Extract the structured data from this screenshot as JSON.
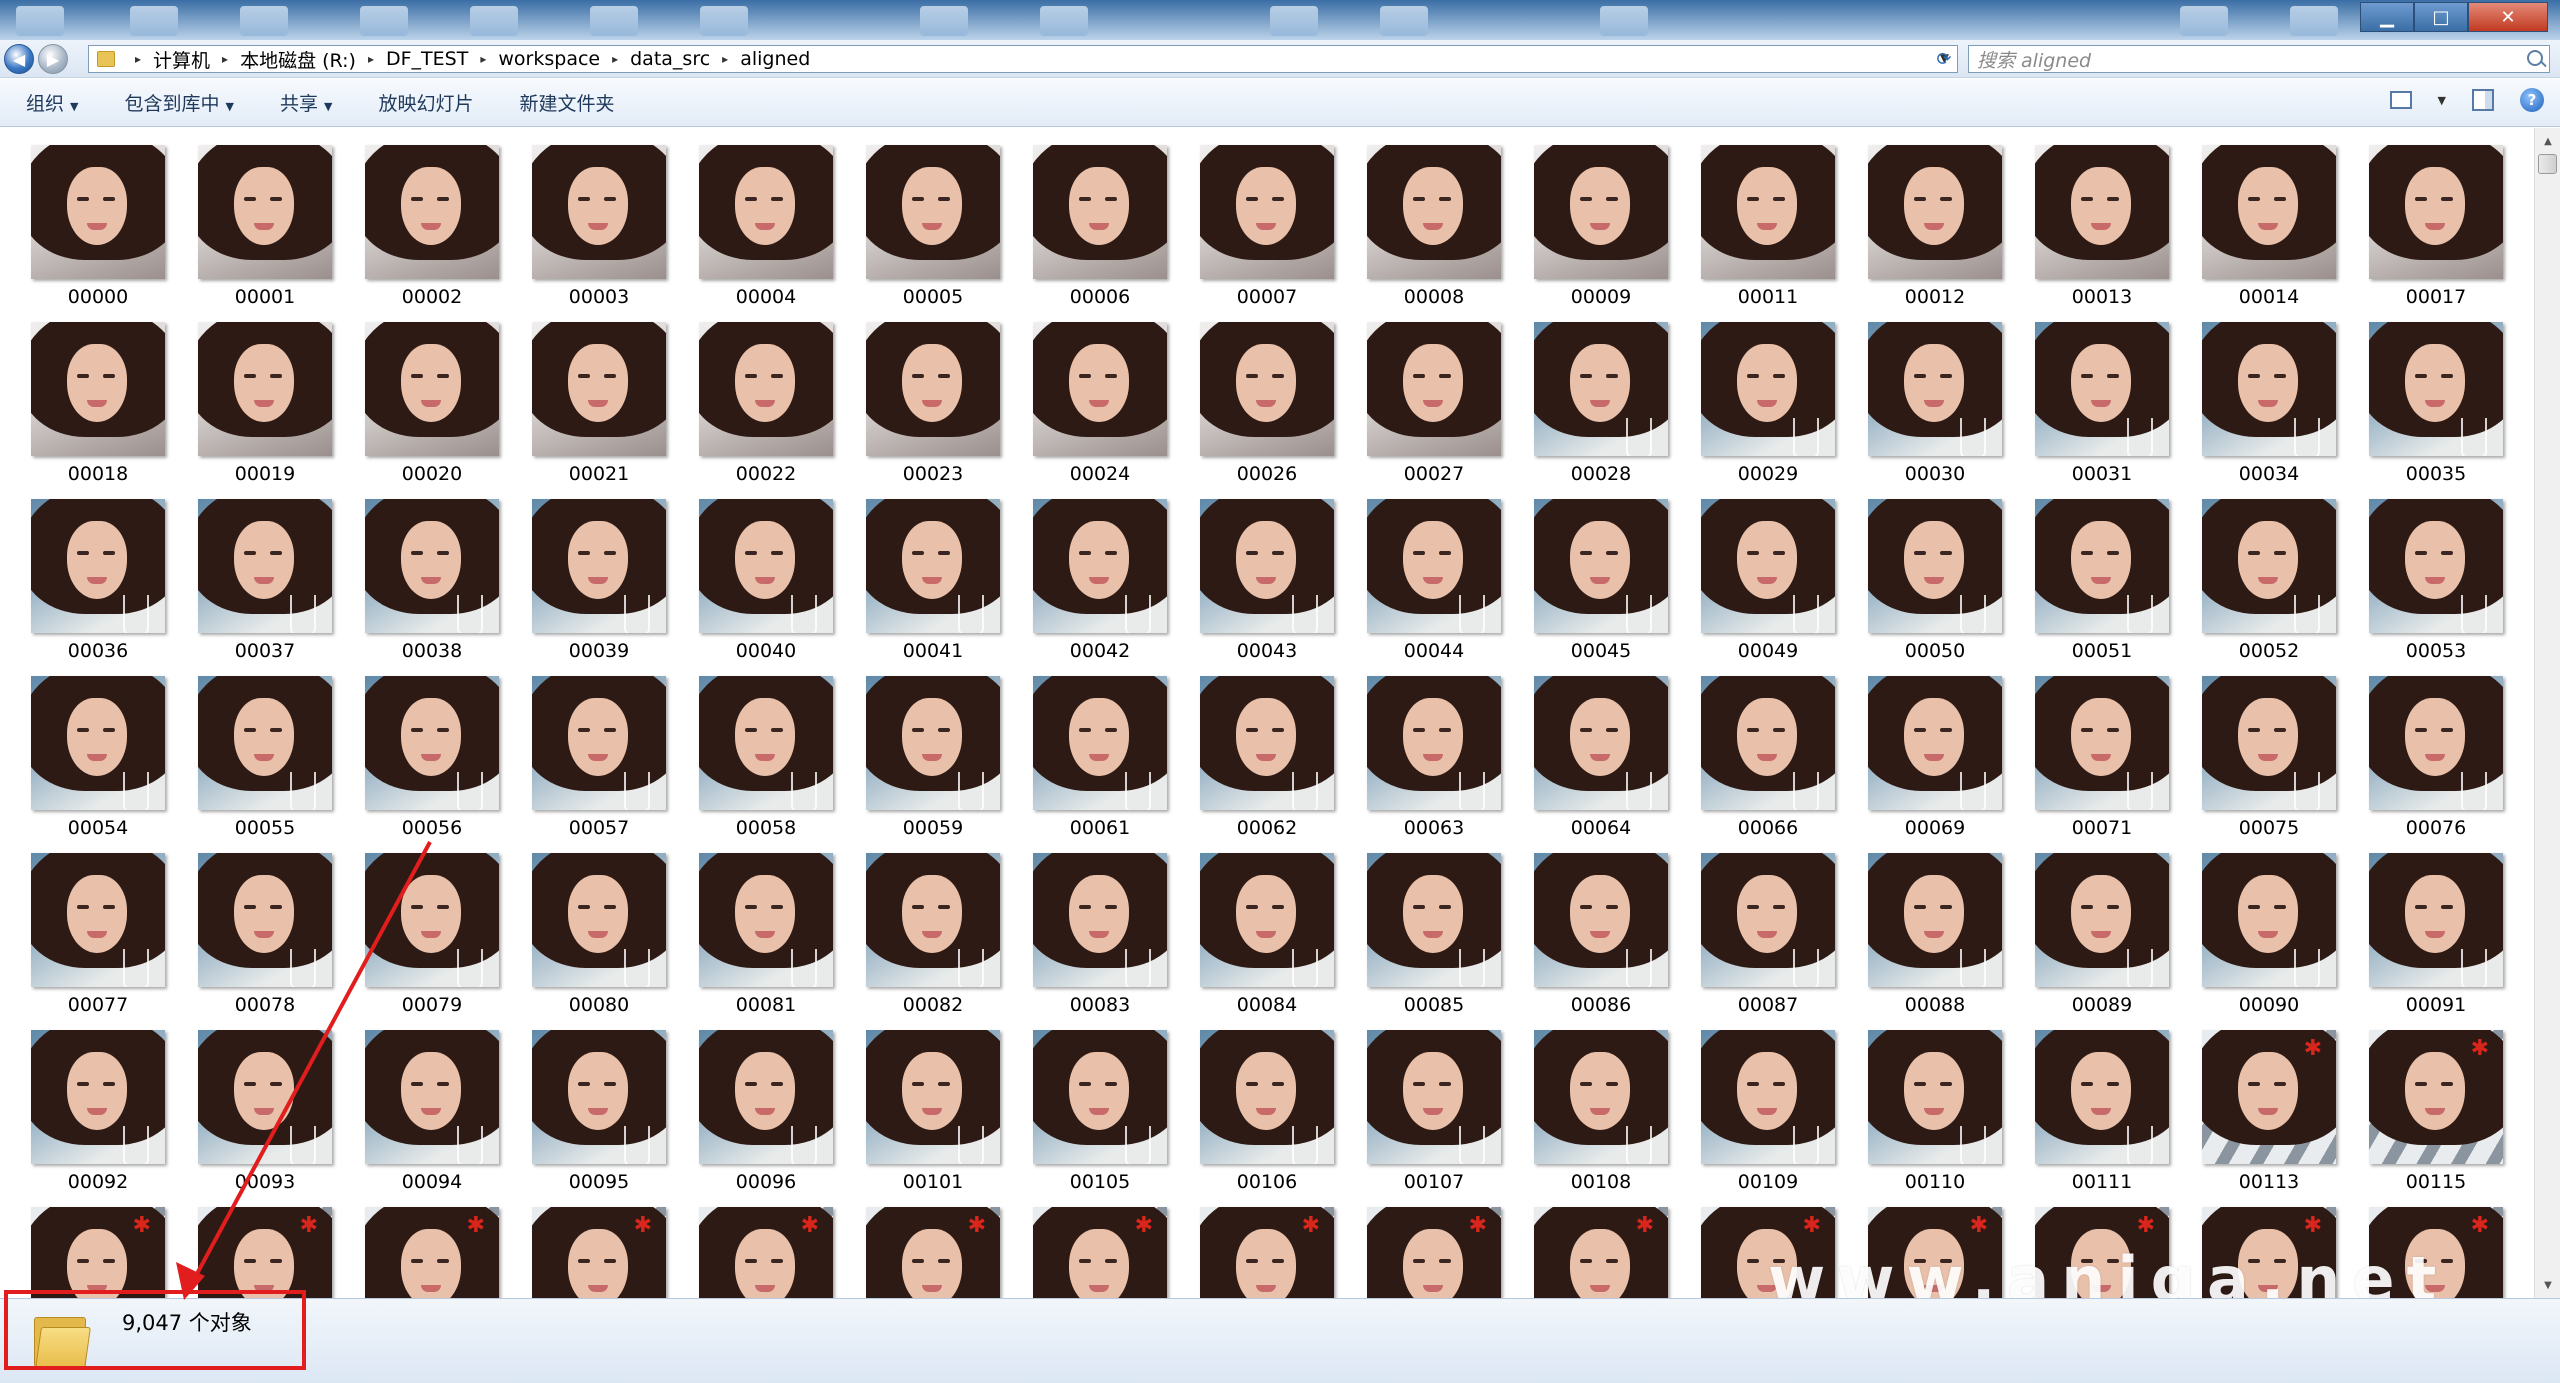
{
  "window": {
    "controls": {
      "minimize": "▁",
      "maximize": "□",
      "close": "✕"
    }
  },
  "address": {
    "breadcrumbs": [
      "计算机",
      "本地磁盘 (R:)",
      "DF_TEST",
      "workspace",
      "data_src",
      "aligned"
    ],
    "search_placeholder": "搜索 aligned"
  },
  "toolbar": {
    "items": [
      {
        "label": "组织",
        "dropdown": true
      },
      {
        "label": "包含到库中",
        "dropdown": true
      },
      {
        "label": "共享",
        "dropdown": true
      },
      {
        "label": "放映幻灯片",
        "dropdown": false
      },
      {
        "label": "新建文件夹",
        "dropdown": false
      }
    ],
    "right_icons": [
      "view-options-icon",
      "preview-pane-icon",
      "help-icon"
    ],
    "help_glyph": "?"
  },
  "files": [
    {
      "name": "00000",
      "thumb": "pillow"
    },
    {
      "name": "00001",
      "thumb": "pillow"
    },
    {
      "name": "00002",
      "thumb": "pillow"
    },
    {
      "name": "00003",
      "thumb": "pillow"
    },
    {
      "name": "00004",
      "thumb": "pillow"
    },
    {
      "name": "00005",
      "thumb": "pillow"
    },
    {
      "name": "00006",
      "thumb": "pillow"
    },
    {
      "name": "00007",
      "thumb": "pillow"
    },
    {
      "name": "00008",
      "thumb": "pillow"
    },
    {
      "name": "00009",
      "thumb": "pillow"
    },
    {
      "name": "00011",
      "thumb": "pillow"
    },
    {
      "name": "00012",
      "thumb": "pillow"
    },
    {
      "name": "00013",
      "thumb": "pillow"
    },
    {
      "name": "00014",
      "thumb": "pillow"
    },
    {
      "name": "00017",
      "thumb": "pillow"
    },
    {
      "name": "00018",
      "thumb": "pillow"
    },
    {
      "name": "00019",
      "thumb": "pillow"
    },
    {
      "name": "00020",
      "thumb": "pillow"
    },
    {
      "name": "00021",
      "thumb": "pillow"
    },
    {
      "name": "00022",
      "thumb": "pillow"
    },
    {
      "name": "00023",
      "thumb": "pillow"
    },
    {
      "name": "00024",
      "thumb": "pillow"
    },
    {
      "name": "00026",
      "thumb": "pillow"
    },
    {
      "name": "00027",
      "thumb": "pillow"
    },
    {
      "name": "00028",
      "thumb": "blue"
    },
    {
      "name": "00029",
      "thumb": "blue"
    },
    {
      "name": "00030",
      "thumb": "blue"
    },
    {
      "name": "00031",
      "thumb": "blue"
    },
    {
      "name": "00034",
      "thumb": "blue"
    },
    {
      "name": "00035",
      "thumb": "blue"
    },
    {
      "name": "00036",
      "thumb": "blue"
    },
    {
      "name": "00037",
      "thumb": "blue"
    },
    {
      "name": "00038",
      "thumb": "blue"
    },
    {
      "name": "00039",
      "thumb": "blue"
    },
    {
      "name": "00040",
      "thumb": "blue"
    },
    {
      "name": "00041",
      "thumb": "blue"
    },
    {
      "name": "00042",
      "thumb": "blue"
    },
    {
      "name": "00043",
      "thumb": "blue"
    },
    {
      "name": "00044",
      "thumb": "blue"
    },
    {
      "name": "00045",
      "thumb": "blue"
    },
    {
      "name": "00049",
      "thumb": "blue"
    },
    {
      "name": "00050",
      "thumb": "blue"
    },
    {
      "name": "00051",
      "thumb": "blue"
    },
    {
      "name": "00052",
      "thumb": "blue"
    },
    {
      "name": "00053",
      "thumb": "blue"
    },
    {
      "name": "00054",
      "thumb": "blue"
    },
    {
      "name": "00055",
      "thumb": "blue"
    },
    {
      "name": "00056",
      "thumb": "blue"
    },
    {
      "name": "00057",
      "thumb": "blue"
    },
    {
      "name": "00058",
      "thumb": "blue"
    },
    {
      "name": "00059",
      "thumb": "blue"
    },
    {
      "name": "00061",
      "thumb": "blue"
    },
    {
      "name": "00062",
      "thumb": "blue"
    },
    {
      "name": "00063",
      "thumb": "blue"
    },
    {
      "name": "00064",
      "thumb": "blue"
    },
    {
      "name": "00066",
      "thumb": "blue"
    },
    {
      "name": "00069",
      "thumb": "blue"
    },
    {
      "name": "00071",
      "thumb": "blue"
    },
    {
      "name": "00075",
      "thumb": "blue"
    },
    {
      "name": "00076",
      "thumb": "blue"
    },
    {
      "name": "00077",
      "thumb": "blue"
    },
    {
      "name": "00078",
      "thumb": "blue"
    },
    {
      "name": "00079",
      "thumb": "blue"
    },
    {
      "name": "00080",
      "thumb": "blue"
    },
    {
      "name": "00081",
      "thumb": "blue"
    },
    {
      "name": "00082",
      "thumb": "blue"
    },
    {
      "name": "00083",
      "thumb": "blue"
    },
    {
      "name": "00084",
      "thumb": "blue"
    },
    {
      "name": "00085",
      "thumb": "blue"
    },
    {
      "name": "00086",
      "thumb": "blue"
    },
    {
      "name": "00087",
      "thumb": "blue"
    },
    {
      "name": "00088",
      "thumb": "blue"
    },
    {
      "name": "00089",
      "thumb": "blue"
    },
    {
      "name": "00090",
      "thumb": "blue"
    },
    {
      "name": "00091",
      "thumb": "blue"
    },
    {
      "name": "00092",
      "thumb": "blue"
    },
    {
      "name": "00093",
      "thumb": "blue"
    },
    {
      "name": "00094",
      "thumb": "blue"
    },
    {
      "name": "00095",
      "thumb": "blue"
    },
    {
      "name": "00096",
      "thumb": "blue"
    },
    {
      "name": "00101",
      "thumb": "blue"
    },
    {
      "name": "00105",
      "thumb": "blue"
    },
    {
      "name": "00106",
      "thumb": "blue"
    },
    {
      "name": "00107",
      "thumb": "blue"
    },
    {
      "name": "00108",
      "thumb": "blue"
    },
    {
      "name": "00109",
      "thumb": "blue"
    },
    {
      "name": "00110",
      "thumb": "blue"
    },
    {
      "name": "00111",
      "thumb": "blue"
    },
    {
      "name": "00113",
      "thumb": "stripe"
    },
    {
      "name": "00115",
      "thumb": "stripe"
    },
    {
      "name": "",
      "thumb": "stripe"
    },
    {
      "name": "",
      "thumb": "stripe"
    },
    {
      "name": "",
      "thumb": "stripe"
    },
    {
      "name": "",
      "thumb": "stripe"
    },
    {
      "name": "",
      "thumb": "stripe"
    },
    {
      "name": "",
      "thumb": "stripe"
    },
    {
      "name": "",
      "thumb": "stripe"
    },
    {
      "name": "",
      "thumb": "stripe"
    },
    {
      "name": "",
      "thumb": "stripe"
    },
    {
      "name": "",
      "thumb": "stripe"
    },
    {
      "name": "",
      "thumb": "stripe"
    },
    {
      "name": "",
      "thumb": "stripe"
    },
    {
      "name": "",
      "thumb": "stripe"
    },
    {
      "name": "",
      "thumb": "stripe"
    },
    {
      "name": "",
      "thumb": "stripe"
    }
  ],
  "status": {
    "count_text": "9,047 个对象"
  },
  "watermark": "www.aniqa.net",
  "colors": {
    "annotation": "#e11d1d",
    "toolbar_text": "#1e395b",
    "thumb_mark": "#d8261c"
  }
}
